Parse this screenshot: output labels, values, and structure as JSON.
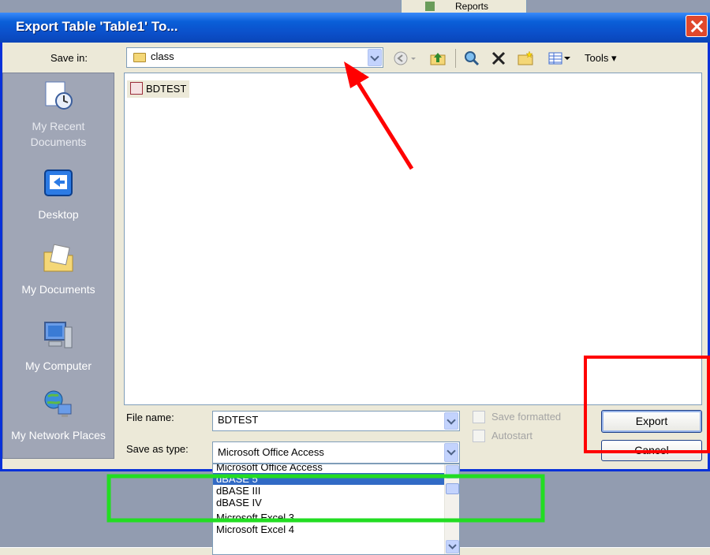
{
  "background": {
    "panel_label": "Reports"
  },
  "dialog": {
    "title": "Export Table 'Table1' To..."
  },
  "save_in": {
    "label": "Save in:",
    "value": "class"
  },
  "toolbar": {
    "tools_label": "Tools"
  },
  "places": [
    {
      "label": "My Recent Documents",
      "icon": "recent-docs-icon"
    },
    {
      "label": "Desktop",
      "icon": "desktop-icon"
    },
    {
      "label": "My Documents",
      "icon": "my-documents-icon"
    },
    {
      "label": "My Computer",
      "icon": "my-computer-icon"
    },
    {
      "label": "My Network Places",
      "icon": "network-places-icon"
    }
  ],
  "files": [
    {
      "name": "BDTEST",
      "icon": "access-db-icon"
    }
  ],
  "file_name": {
    "label": "File name:",
    "value": "BDTEST"
  },
  "save_as_type": {
    "label": "Save as type:",
    "value": "Microsoft Office Access",
    "options": [
      "Microsoft Office Access",
      "dBASE 5",
      "dBASE III",
      "dBASE IV",
      "Microsoft Excel 3",
      "Microsoft Excel 4"
    ],
    "selected": "dBASE 5"
  },
  "checkboxes": {
    "save_formatted": "Save formatted",
    "autostart": "Autostart"
  },
  "buttons": {
    "export": "Export",
    "cancel": "Cancel"
  },
  "colors": {
    "title_bar": "#0a5fd8",
    "selection": "#316ac5",
    "annotation_red": "#ff0000",
    "annotation_green": "#22dd22"
  }
}
